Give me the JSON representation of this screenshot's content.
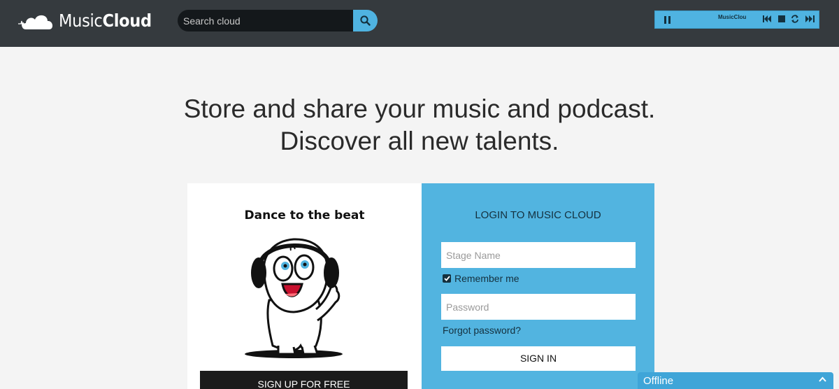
{
  "header": {
    "logo_regular": "Music",
    "logo_bold": "Cloud",
    "search_placeholder": "Search cloud",
    "search_icon": "search-icon"
  },
  "player": {
    "title": "MusicClou",
    "controls": [
      "pause-icon",
      "skip-back-icon",
      "stop-icon",
      "repeat-icon",
      "skip-forward-icon"
    ]
  },
  "hero": {
    "line1": "Store and share your music and podcast.",
    "line2": "Discover all new talents."
  },
  "promo": {
    "title": "Dance to the beat",
    "signup_label": "SIGN UP FOR FREE"
  },
  "login": {
    "title": "LOGIN TO MUSIC CLOUD",
    "stage_name_placeholder": "Stage Name",
    "remember_label": "Remember me",
    "remember_checked": true,
    "password_placeholder": "Password",
    "forgot_label": "Forgot password?",
    "signin_label": "SIGN IN"
  },
  "chat": {
    "status_label": "Offline"
  },
  "colors": {
    "topbar": "#353a3e",
    "accent": "#52b4e0",
    "background": "#f4f4f4"
  }
}
